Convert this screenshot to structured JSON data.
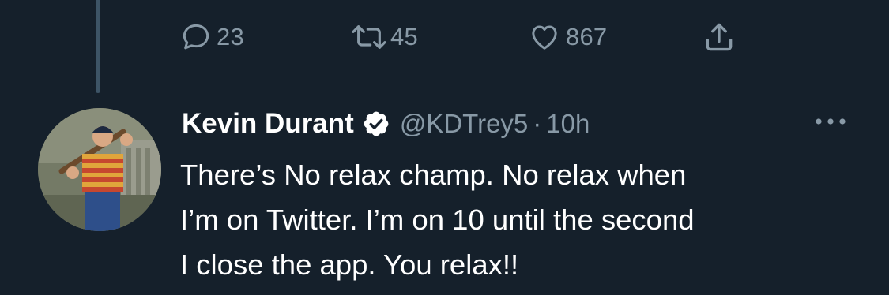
{
  "thread": {
    "previous_tweet_actions": {
      "reply_count": "23",
      "retweet_count": "45",
      "like_count": "867"
    }
  },
  "tweet": {
    "display_name": "Kevin Durant",
    "handle": "@KDTrey5",
    "separator": "·",
    "time": "10h",
    "text": "There’s No relax champ. No relax when\nI’m on Twitter. I’m on 10 until the second\nI close the app. You relax!!",
    "verified": true
  },
  "colors": {
    "background": "#15202b",
    "secondary_text": "#8899a6",
    "primary_text": "#ffffff",
    "thread_line": "#3d5466"
  },
  "icons": {
    "reply": "reply-icon",
    "retweet": "retweet-icon",
    "like": "like-icon",
    "share": "share-icon",
    "verified": "verified-badge-icon",
    "more": "more-options-icon"
  }
}
